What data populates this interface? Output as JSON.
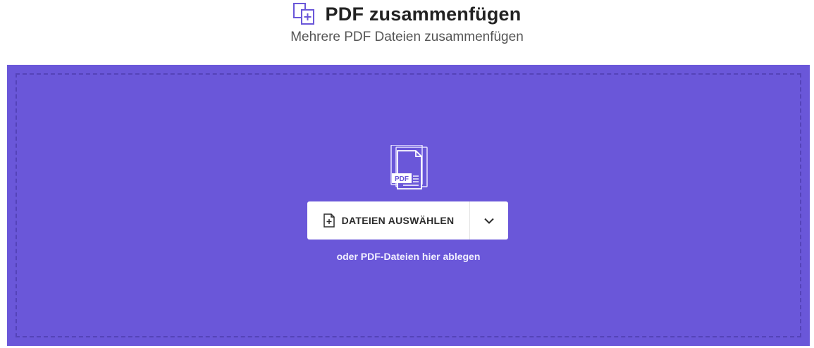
{
  "header": {
    "title": "PDF zusammenfügen",
    "subtitle": "Mehrere PDF Dateien zusammenfügen",
    "icon": "merge-pages-icon"
  },
  "dropzone": {
    "illustration_icon": "pdf-documents-icon",
    "illustration_label": "PDF",
    "choose_files_label": "DATEIEN AUSWÄHLEN",
    "choose_files_icon": "add-file-icon",
    "dropdown_icon": "chevron-down-icon",
    "drop_hint": "oder PDF-Dateien hier ablegen"
  },
  "colors": {
    "accent": "#6a57d9",
    "accent_dark": "#5443b8",
    "title_text": "#222222",
    "subtitle_text": "#555555"
  }
}
